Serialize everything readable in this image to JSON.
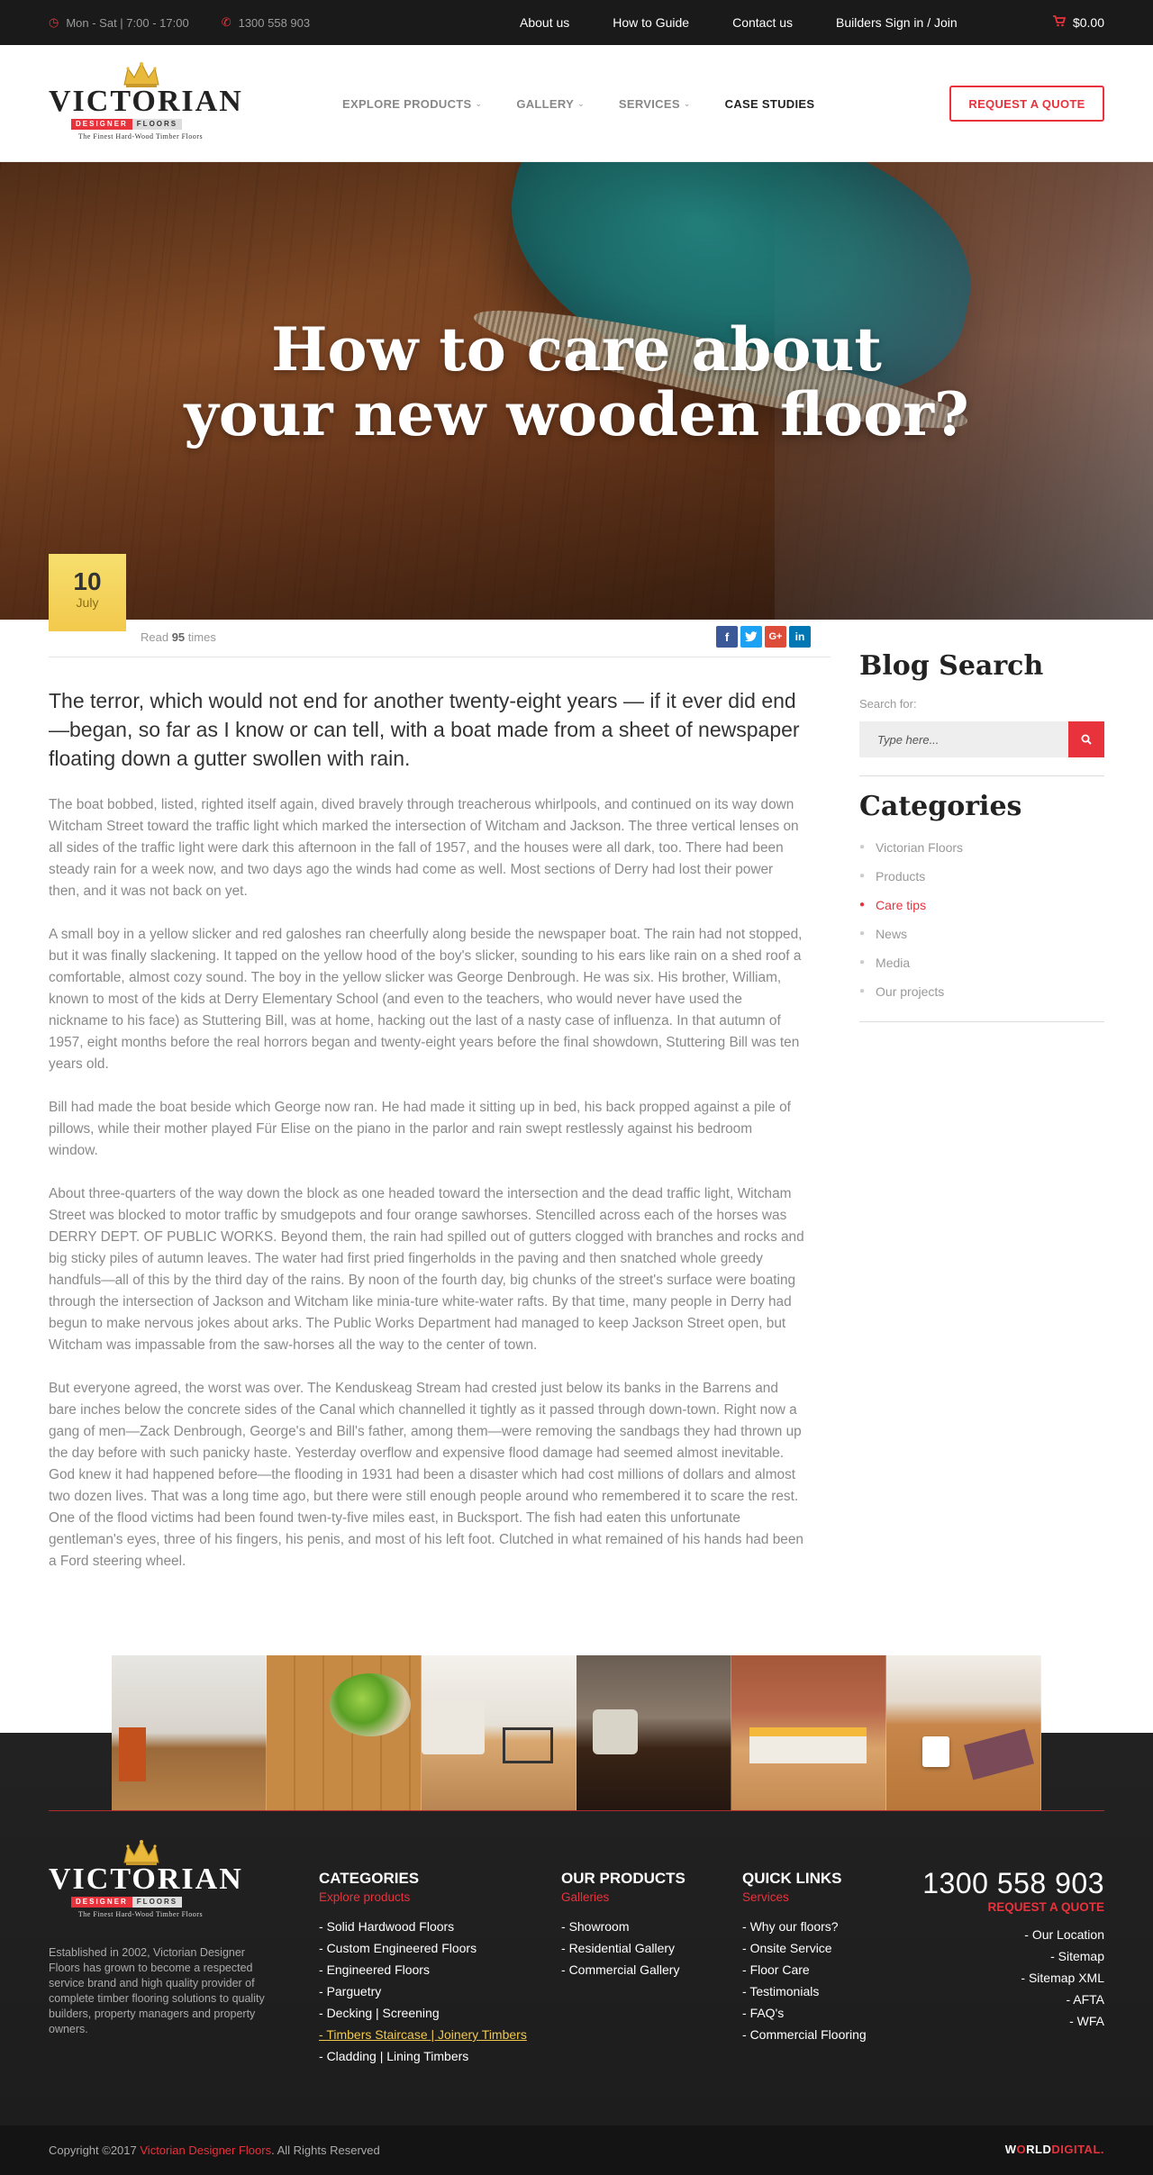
{
  "topbar": {
    "hours": "Mon - Sat | 7:00 - 17:00",
    "phone": "1300 558 903",
    "nav": [
      "About us",
      "How to Guide",
      "Contact us",
      "Builders Sign in / Join"
    ],
    "cart_total": "$0.00"
  },
  "logo": {
    "brand": "VICTORIAN",
    "ribbon_left": "DESIGNER",
    "ribbon_right": "FLOORS",
    "tagline": "The Finest Hard-Wood Timber Floors"
  },
  "mainnav": {
    "items": [
      {
        "label": "EXPLORE PRODUCTS"
      },
      {
        "label": "GALLERY"
      },
      {
        "label": "SERVICES"
      },
      {
        "label": "CASE STUDIES"
      }
    ],
    "quote_button": "REQUEST A QUOTE"
  },
  "hero": {
    "title_line1": "How to care about",
    "title_line2": "your new wooden floor?"
  },
  "post": {
    "date_day": "10",
    "date_month": "July",
    "read_prefix": "Read",
    "read_count": "95",
    "read_suffix": "times",
    "lead": "The terror, which would not end for another twenty-eight years — if it ever did end—began, so far as I know or can tell, with a boat made from a sheet of newspaper floating down a gutter swollen with rain.",
    "paragraphs": [
      "The boat bobbed, listed, righted itself again, dived bravely through treacherous whirlpools, and continued on its way down Witcham Street toward the traffic light which marked the intersection of Witcham and Jackson. The three vertical lenses on all sides of the traffic light were dark this afternoon in the fall of 1957, and the houses were all dark, too. There had been steady rain for a week now, and two days ago the winds had come as well. Most sections of Derry had lost their power then, and it was not back on yet.",
      "A small boy in a yellow slicker and red galoshes ran cheerfully along beside the newspaper boat. The rain had not stopped, but it was finally slackening. It tapped on the yellow hood of the boy's slicker, sounding to his ears like rain on a shed roof a comfortable, almost cozy sound. The boy in the yellow slicker was George Denbrough. He was six. His brother, William, known to most of the kids at Derry Elementary School (and even to the teachers, who would never have used the nickname to his face) as Stuttering Bill, was at home, hacking out the last of a nasty case of influenza. In that autumn of 1957, eight months before the real horrors began and twenty-eight years before the final showdown, Stuttering Bill was ten years old.",
      "Bill had made the boat beside which George now ran. He had made it sitting up in bed, his back propped against a pile of pillows, while their mother played Für Elise on the piano in the parlor and rain swept restlessly against his bedroom window.",
      "About three-quarters of the way down the block as one headed toward the intersection and the dead traffic light, Witcham Street was blocked to motor traffic by smudgepots and four orange sawhorses. Stencilled across each of the horses was DERRY DEPT. OF PUBLIC WORKS. Beyond them, the rain had spilled out of gutters clogged with branches and rocks and big sticky piles of autumn leaves. The water had first pried fingerholds in the paving and then snatched whole greedy handfuls—all of this by the third day of the rains. By noon of the fourth day, big chunks of the street's surface were boating through the intersection of Jackson and Witcham like minia-ture white-water rafts. By that time, many people in Derry had begun to make nervous jokes about arks. The Public Works Department had managed to keep Jackson Street open, but Witcham was impassable from the saw-horses all the way to the center of town.",
      "But everyone agreed, the worst was over. The Kenduskeag Stream had crested just below its banks in the Barrens and bare inches below the concrete sides of the Canal which channelled it tightly as it passed through down-town. Right now a gang of men—Zack Denbrough, George's and Bill's father, among them—were removing the sandbags they had thrown up the day before with such panicky haste. Yesterday overflow and expensive flood damage had seemed almost inevitable. God knew it had happened before—the flooding in 1931 had been a disaster which had cost millions of dollars and almost two dozen lives. That was a long time ago, but there were still enough people around who remembered it to scare the rest. One of the flood victims had been found twen-ty-five miles east, in Bucksport. The fish had eaten this unfortunate gentleman's eyes, three of his fingers, his penis, and most of his left foot. Clutched in what remained of his hands had been a Ford steering wheel."
    ]
  },
  "sidebar": {
    "search_title": "Blog Search",
    "search_label": "Search for:",
    "search_placeholder": "Type here...",
    "categories_title": "Categories",
    "categories": [
      "Victorian Floors",
      "Products",
      "Care tips",
      "News",
      "Media",
      "Our projects"
    ],
    "active_category": "Care tips"
  },
  "footer": {
    "about": "Established in 2002, Victorian Designer Floors has grown to become a respected service brand and high quality provider of complete timber flooring solutions to quality builders, property managers and property owners.",
    "col1": {
      "title": "CATEGORIES",
      "sub": "Explore products",
      "items": [
        "Solid Hardwood Floors",
        "Custom Engineered Floors",
        "Engineered Floors",
        "Parguetry",
        "Decking | Screening",
        "Timbers Staircase | Joinery Timbers",
        "Cladding | Lining Timbers"
      ]
    },
    "col2": {
      "title": "OUR PRODUCTS",
      "sub": "Galleries",
      "items": [
        "Showroom",
        "Residential Gallery",
        "Commercial Gallery"
      ]
    },
    "col3": {
      "title": "QUICK LINKS",
      "sub": "Services",
      "items": [
        "Why our floors?",
        "Onsite Service",
        "Floor Care",
        "Testimonials",
        "FAQ's",
        "Commercial Flooring"
      ]
    },
    "col4": {
      "phone": "1300 558 903",
      "sub": "REQUEST A QUOTE",
      "items": [
        "Our Location",
        "Sitemap",
        "Sitemap XML",
        "AFTA",
        "WFA"
      ]
    }
  },
  "bottombar": {
    "copy_prefix": "Copyright ©2017",
    "brand": "Victorian Designer Floors",
    "copy_suffix": ". All Rights Reserved",
    "credit_a": "W",
    "credit_o": "O",
    "credit_b": "RLD",
    "credit_c": "DIGITAL."
  },
  "colors": {
    "accent": "#e8323c",
    "topbar": "#1a1a1a",
    "footer": "#222222",
    "date_badge": "#f2c94c"
  }
}
